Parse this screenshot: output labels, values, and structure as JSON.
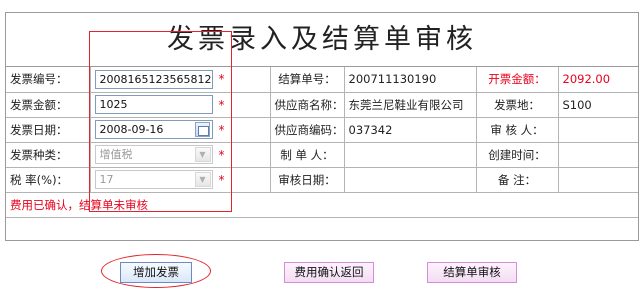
{
  "title": "发票录入及结算单审核",
  "rows": [
    {
      "label1": "发票编号：",
      "input1": "2008165123565812",
      "label2": "结算单号：",
      "value2": "200711130190",
      "label3": "开票金额：",
      "value3": "2092.00"
    },
    {
      "label1": "发票金额：",
      "input1": "1025",
      "label2": "供应商名称：",
      "value2": "东莞兰尼鞋业有限公司",
      "label3": "发票地：",
      "value3": "S100"
    },
    {
      "label1": "发票日期：",
      "input1": "2008-09-16",
      "label2": "供应商编码：",
      "value2": "037342",
      "label3": "审 核 人：",
      "value3": ""
    },
    {
      "label1": "发票种类：",
      "input1": "增值税",
      "label2": "制 单 人：",
      "value2": "",
      "label3": "创建时间：",
      "value3": ""
    },
    {
      "label1": "税 率(%)：",
      "input1": "17",
      "label2": "审核日期：",
      "value2": "",
      "label3": "备 注：",
      "value3": ""
    }
  ],
  "required_mark": "*",
  "status": "费用已确认，结算单未审核",
  "buttons": {
    "add_invoice": "增加发票",
    "confirm_return": "费用确认返回",
    "approve": "结算单审核"
  },
  "colors": {
    "required": "#e8001c",
    "highlight": "#e0262c",
    "border": "#b4b4b4"
  }
}
